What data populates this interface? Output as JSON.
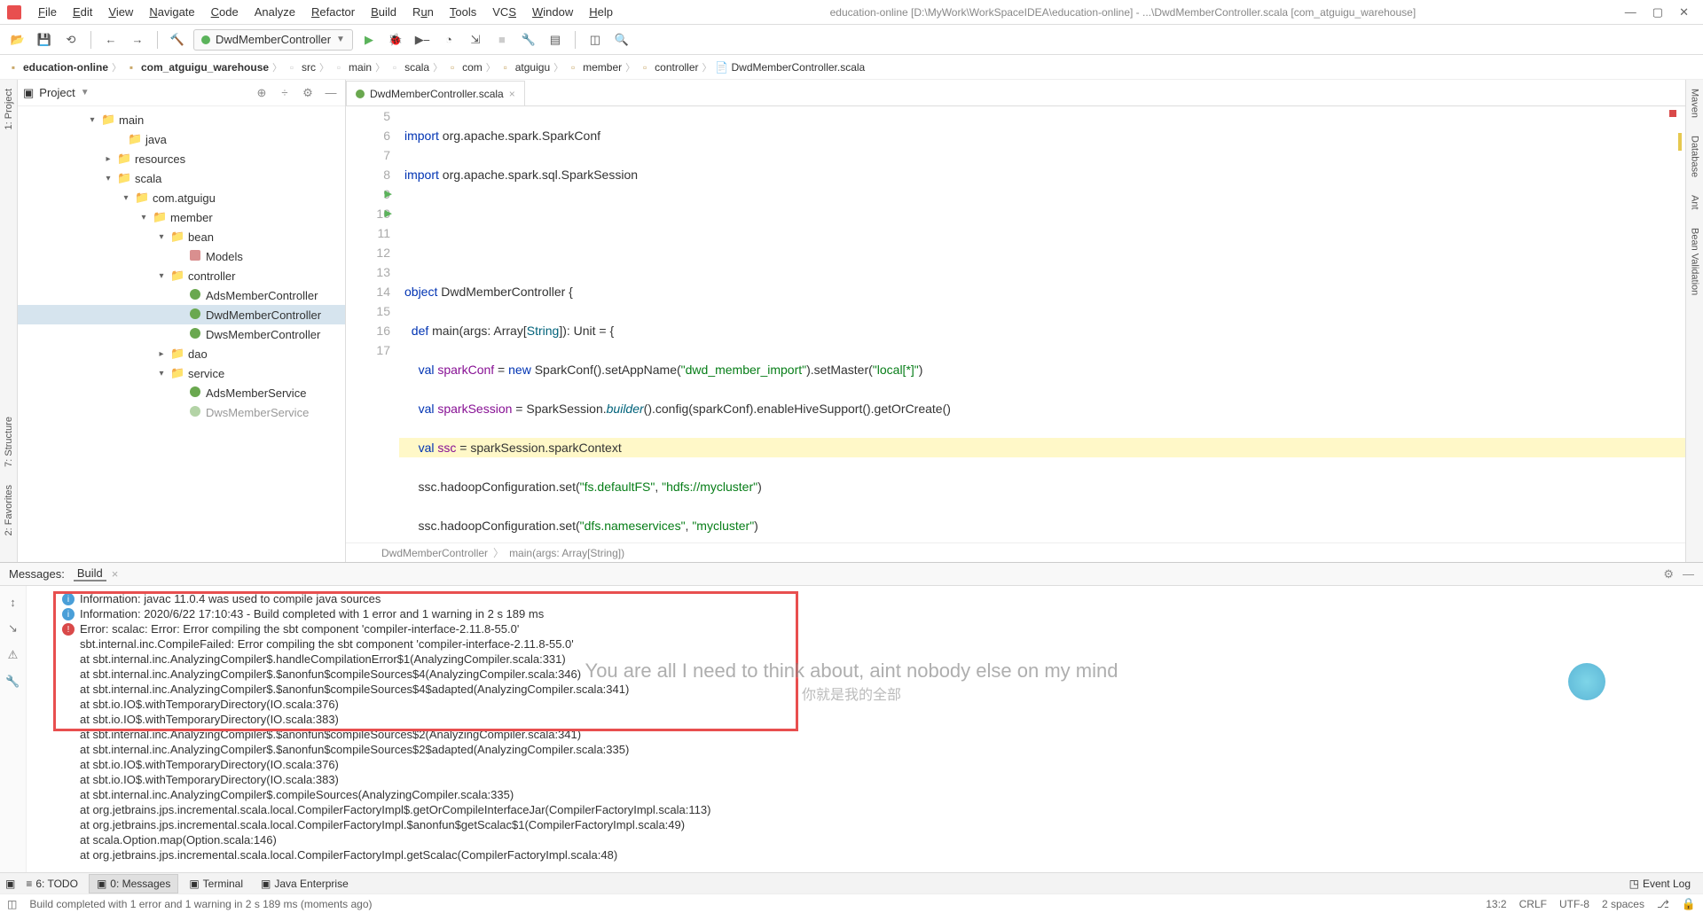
{
  "window": {
    "title": "education-online [D:\\MyWork\\WorkSpaceIDEA\\education-online] - ...\\DwdMemberController.scala [com_atguigu_warehouse]"
  },
  "menu": {
    "file": "File",
    "edit": "Edit",
    "view": "View",
    "navigate": "Navigate",
    "code": "Code",
    "analyze": "Analyze",
    "refactor": "Refactor",
    "build": "Build",
    "run": "Run",
    "tools": "Tools",
    "vcs": "VCS",
    "window": "Window",
    "help": "Help"
  },
  "runConfig": {
    "name": "DwdMemberController"
  },
  "breadcrumb": [
    {
      "label": "education-online",
      "icon": "folder"
    },
    {
      "label": "com_atguigu_warehouse",
      "icon": "folder"
    },
    {
      "label": "src",
      "icon": "lightfolder"
    },
    {
      "label": "main",
      "icon": "lightfolder"
    },
    {
      "label": "scala",
      "icon": "lightfolder"
    },
    {
      "label": "com",
      "icon": "package"
    },
    {
      "label": "atguigu",
      "icon": "package"
    },
    {
      "label": "member",
      "icon": "package"
    },
    {
      "label": "controller",
      "icon": "package"
    },
    {
      "label": "DwdMemberController.scala",
      "icon": "file"
    }
  ],
  "leftRail": {
    "project": "1: Project",
    "structure": "7: Structure",
    "favorites": "2: Favorites"
  },
  "rightRail": {
    "maven": "Maven",
    "database": "Database",
    "ant": "Ant",
    "bean": "Bean Validation"
  },
  "projectPanel": {
    "title": "Project"
  },
  "tree": {
    "main": "main",
    "java": "java",
    "resources": "resources",
    "scala": "scala",
    "comatguigu": "com.atguigu",
    "member": "member",
    "bean": "bean",
    "models": "Models",
    "controller": "controller",
    "ads": "AdsMemberController",
    "dwd": "DwdMemberController",
    "dws": "DwsMemberController",
    "dao": "dao",
    "service": "service",
    "adsService": "AdsMemberService",
    "dwsService": "DwsMemberService"
  },
  "editorTab": {
    "name": "DwdMemberController.scala"
  },
  "code": {
    "lines": [
      5,
      6,
      7,
      8,
      9,
      10,
      11,
      12,
      13,
      14,
      15,
      16,
      17
    ]
  },
  "codeStatus": {
    "scope": "DwdMemberController",
    "func": "main(args: Array[String])"
  },
  "messages": {
    "title": "Messages:",
    "tab": "Build",
    "info1": "Information: javac 11.0.4 was used to compile java sources",
    "info2": "Information: 2020/6/22 17:10:43 - Build completed with 1 error and 1 warning in 2 s 189 ms",
    "error": "Error: scalac: Error: Error compiling the sbt component 'compiler-interface-2.11.8-55.0'",
    "stack": [
      "sbt.internal.inc.CompileFailed: Error compiling the sbt component 'compiler-interface-2.11.8-55.0'",
      "at sbt.internal.inc.AnalyzingCompiler$.handleCompilationError$1(AnalyzingCompiler.scala:331)",
      "at sbt.internal.inc.AnalyzingCompiler$.$anonfun$compileSources$4(AnalyzingCompiler.scala:346)",
      "at sbt.internal.inc.AnalyzingCompiler$.$anonfun$compileSources$4$adapted(AnalyzingCompiler.scala:341)",
      "at sbt.io.IO$.withTemporaryDirectory(IO.scala:376)",
      "at sbt.io.IO$.withTemporaryDirectory(IO.scala:383)",
      "at sbt.internal.inc.AnalyzingCompiler$.$anonfun$compileSources$2(AnalyzingCompiler.scala:341)",
      "at sbt.internal.inc.AnalyzingCompiler$.$anonfun$compileSources$2$adapted(AnalyzingCompiler.scala:335)",
      "at sbt.io.IO$.withTemporaryDirectory(IO.scala:376)",
      "at sbt.io.IO$.withTemporaryDirectory(IO.scala:383)",
      "at sbt.internal.inc.AnalyzingCompiler$.compileSources(AnalyzingCompiler.scala:335)",
      "at org.jetbrains.jps.incremental.scala.local.CompilerFactoryImpl$.getOrCompileInterfaceJar(CompilerFactoryImpl.scala:113)",
      "at org.jetbrains.jps.incremental.scala.local.CompilerFactoryImpl.$anonfun$getScalac$1(CompilerFactoryImpl.scala:49)",
      "at scala.Option.map(Option.scala:146)",
      "at org.jetbrains.jps.incremental.scala.local.CompilerFactoryImpl.getScalac(CompilerFactoryImpl.scala:48)"
    ]
  },
  "bottomBar": {
    "todo": "6: TODO",
    "messages": "0: Messages",
    "terminal": "Terminal",
    "javaee": "Java Enterprise",
    "eventlog": "Event Log"
  },
  "statusBar": {
    "text": "Build completed with 1 error and 1 warning in 2 s 189 ms (moments ago)",
    "pos": "13:2",
    "le": "CRLF",
    "enc": "UTF-8",
    "indent": "2 spaces"
  },
  "lyrics": {
    "en": "You are all I need to think about, aint nobody else on my mind",
    "cn": "你就是我的全部"
  }
}
